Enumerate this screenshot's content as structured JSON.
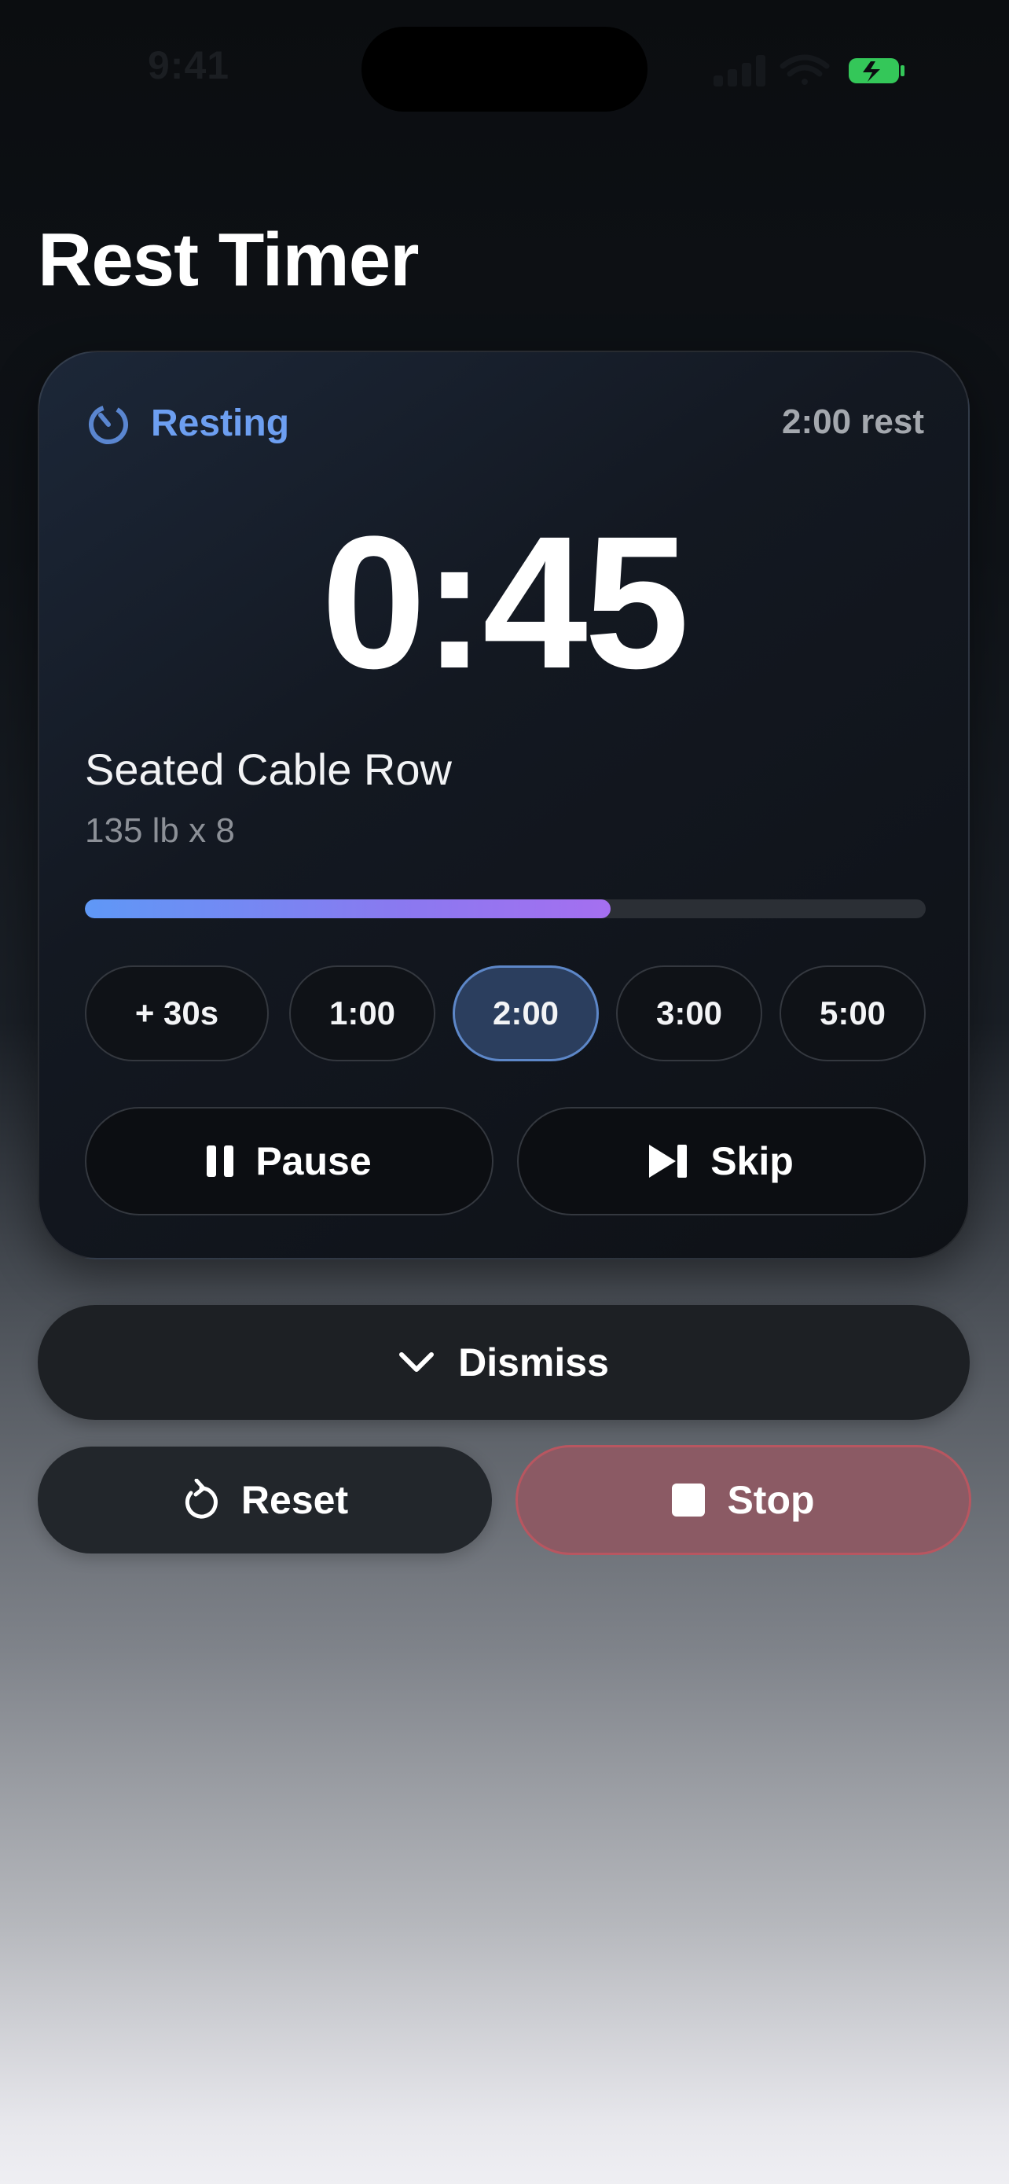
{
  "status_bar": {
    "time": "9:41"
  },
  "header": {
    "title": "Rest Timer"
  },
  "timer": {
    "state_label": "Resting",
    "state_icon": "timer-icon",
    "rest_duration_label": "2:00 rest",
    "countdown": "0:45",
    "exercise_name": "Seated Cable Row",
    "exercise_detail": "135 lb x 8",
    "progress_fraction": 0.625,
    "presets": [
      {
        "label": "+ 30s",
        "selected": false
      },
      {
        "label": "1:00",
        "selected": false
      },
      {
        "label": "2:00",
        "selected": true
      },
      {
        "label": "3:00",
        "selected": false
      },
      {
        "label": "5:00",
        "selected": false
      }
    ],
    "pause_label": "Pause",
    "pause_icon": "pause-icon",
    "skip_label": "Skip",
    "skip_icon": "skip-forward-icon"
  },
  "actions": {
    "dismiss_label": "Dismiss",
    "dismiss_icon": "chevron-down-icon",
    "reset_label": "Reset",
    "reset_icon": "reset-icon",
    "stop_label": "Stop",
    "stop_icon": "stop-icon"
  },
  "colors": {
    "accent_blue": "#6d9ff1",
    "progress_start": "#5f98f6",
    "progress_end": "#a56ff0",
    "stop_fill": "#8b5a64",
    "stop_border": "#b85660",
    "battery_green": "#34c759"
  }
}
